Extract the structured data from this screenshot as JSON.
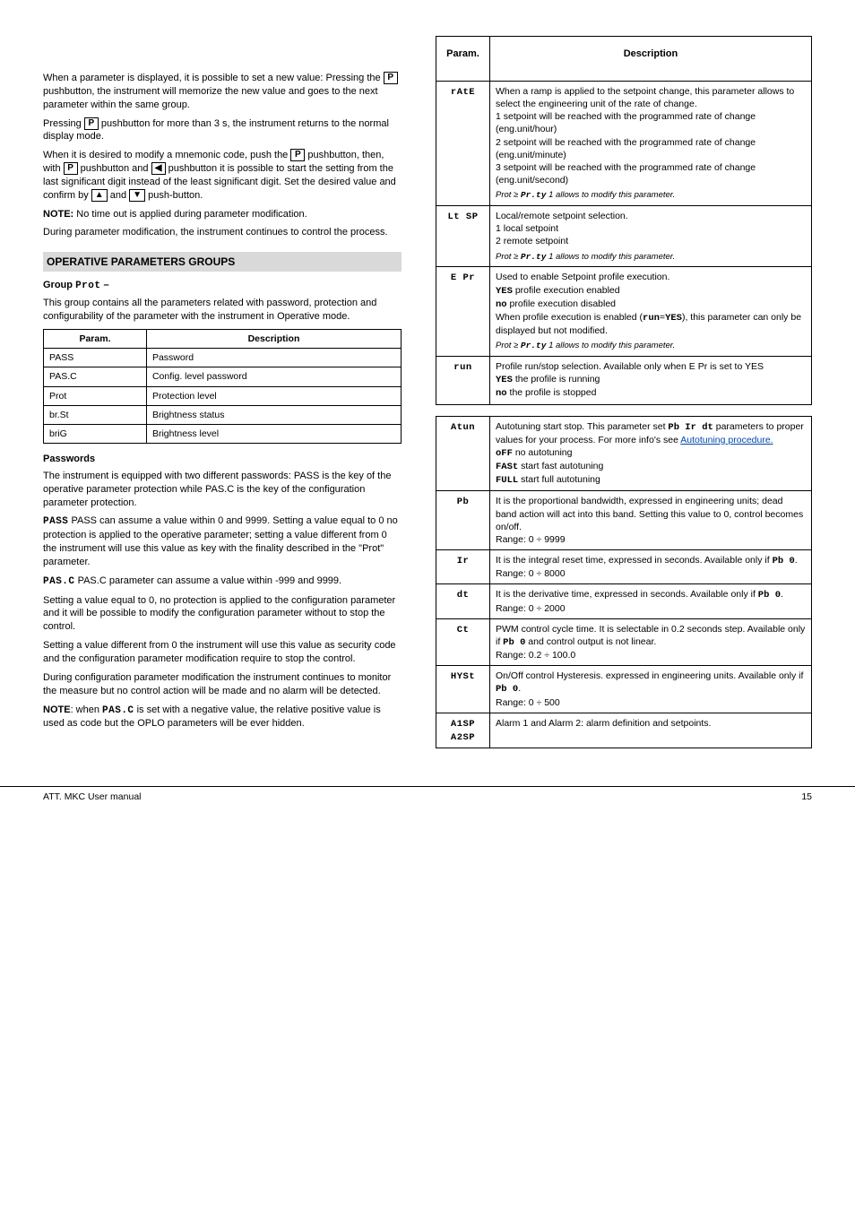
{
  "left": {
    "para1_a": "When a parameter is displayed, it is possible to set a new value: Pressing the ",
    "key_P": "P",
    "para1_b": " pushbutton, the instrument will memorize the new value and goes to the next parameter within the same group.",
    "para2_a": "Pressing ",
    "para2_b": " pushbutton for more than 3 s, the instrument returns to the normal display mode.",
    "para3_a": "When it is desired to modify a mnemonic code, push the ",
    "para3_b": " pushbutton, then, with ",
    "para3_c": " pushbutton and ",
    "key_left": "◀",
    "para3_d": "  pushbutton it is possible to start the setting from the last significant digit instead of the least significant digit. Set the desired value and confirm by ",
    "key_up": "▲",
    "para3_e": " and ",
    "key_down": "▼",
    "para3_f": " push-button.",
    "note1_label": "NOTE: ",
    "note1_text": "No time out is applied during parameter modification.",
    "para4": "During parameter modification, the instrument continues to control the process.",
    "operative_groups_title": "OPERATIVE PARAMETERS GROUPS",
    "prot_head": "Group Prot – ",
    "prot_intro_a": "Prot",
    "prot_intro_b": "This group contains all the parameters related with password, protection and configurability of the parameter with the instrument in Operative mode.",
    "table_head_param": "Param.",
    "table_head_desc": "Description",
    "prot_rows": [
      {
        "p": "PASS",
        "d": "Password"
      },
      {
        "p": "PAS.C",
        "d": "Config. level password"
      },
      {
        "p": "Prot",
        "d": "Protection level"
      },
      {
        "p": "br.St",
        "d": "Brightness status"
      },
      {
        "p": "briG",
        "d": "Brightness level"
      }
    ],
    "passwords_head": "Passwords",
    "pass1": "The instrument is equipped with two different passwords: PASS is the key of the operative parameter protection while PAS.C is the key of the configuration parameter protection.",
    "pass_label": "PASS",
    "pass2": "PASS can assume a value within 0 and 9999. Setting a value equal to 0 no protection is applied to the operative parameter; setting a value different from 0 the instrument will use this value as key with the finality described in the \"Prot\" parameter.",
    "pasc_label": "PAS.C",
    "pasc1": "PAS.C parameter can assume a value within -999 and 9999.",
    "pasc2": "Setting a value equal to 0, no protection is applied to the configuration parameter and it will be possible to modify the configuration parameter without to stop the control.",
    "pasc3": "Setting a value different from 0 the instrument will use this value as security code and the configuration parameter modification require to stop the control.",
    "pasc4": "During configuration parameter modification the instrument continues to monitor the measure but no control action will be made and no alarm will be detected.",
    "note2_label": "NOTE",
    "note2_text_a": ": when ",
    "note2_text_b": " is set with a negative value, the relative positive value is used as code but the OPLO parameters will be ever hidden."
  },
  "right": {
    "table1_head_param": "Param.",
    "table1_head_desc": "Description",
    "table1": [
      {
        "code": "rAtE",
        "body_lead": "When a ramp is applied to the setpoint change, this parameter allows to select the engineering unit of the rate of change.",
        "opts": [
          "1 setpoint will be reached with the programmed rate of change (eng.unit/hour)",
          "2 setpoint will be reached with the programmed rate of change (eng.unit/minute)",
          "3 setpoint will be reached with the programmed rate of change (eng.unit/second)"
        ],
        "note_code": "Pr.ty",
        "note_text": " 1 allows to modify this parameter."
      },
      {
        "code": "Lt SP",
        "body_lead": "Local/remote setpoint selection.",
        "opts": [
          "1 local setpoint",
          "2 remote setpoint"
        ],
        "note_code": "Pr.ty",
        "note_text": " 1 allows to modify this parameter."
      },
      {
        "code": "E Pr",
        "body_lead": "Used to enable Setpoint profile execution.",
        "opts_rich": [
          {
            "code": "YES",
            "text": " profile execution enabled"
          },
          {
            "code": "no",
            "text": " profile execution disabled"
          }
        ],
        "aux_a": "When profile execution is enabled (",
        "aux_code1": "run",
        "aux_b": "=",
        "aux_code2": "YES",
        "aux_c": "), this parameter can only be displayed but not modified.",
        "note_code": "Pr.ty",
        "note_text": " 1 allows to modify this parameter."
      },
      {
        "code": "run",
        "body_lead": "Profile run/stop selection. Available only when E Pr is set to YES",
        "opts_rich": [
          {
            "code": "YES",
            "text": " the profile is running"
          },
          {
            "code": "no",
            "text": " the profile is stopped"
          }
        ]
      }
    ],
    "table2": [
      {
        "code": "Atun",
        "body_lead_a": "Autotuning start stop. This parameter set ",
        "codes_inline": "Pb Ir dt",
        "body_lead_b": " parameters to proper values for your process. For more info's see ",
        "link": "Autotuning procedure.",
        "opts_rich": [
          {
            "code": "oFF",
            "text": " no autotuning"
          },
          {
            "code": "FASt",
            "text": " start fast autotuning"
          },
          {
            "code": "FULL",
            "text": " start full autotuning"
          }
        ]
      },
      {
        "code": "Pb",
        "body": "It is the proportional bandwidth, expressed in engineering units; dead band action will act into this band. Setting this value to 0, control becomes on/off.",
        "range": "Range: 0 ÷ 9999"
      },
      {
        "code": "Ir",
        "body": "It is the integral reset time, expressed in seconds. Available only if ",
        "cond_code": "Pb 0",
        "cond_tail": ".",
        "range": "Range: 0 ÷ 8000"
      },
      {
        "code": "dt",
        "body": "It is the derivative time, expressed in seconds. Available only if ",
        "cond_code": "Pb 0",
        "cond_tail": ".",
        "range": "Range: 0 ÷ 2000"
      },
      {
        "code": "Ct",
        "body": "PWM control cycle time. It is selectable in 0.2 seconds step. Available only if ",
        "cond_code": "Pb 0",
        "cond_tail": " and control output is not linear.",
        "range": "Range: 0.2 ÷ 100.0"
      },
      {
        "code": "HYSt",
        "body": "On/Off control Hysteresis. expressed in engineering units. Available only if ",
        "cond_code": "Pb 0",
        "cond_tail": ".",
        "range": "Range: 0 ÷ 500"
      },
      {
        "code": "A1SP\nA2SP",
        "body": "Alarm 1 and Alarm 2: alarm definition and setpoints."
      }
    ]
  },
  "footer": {
    "left": "ATT. MKC User manual",
    "right": "15"
  }
}
